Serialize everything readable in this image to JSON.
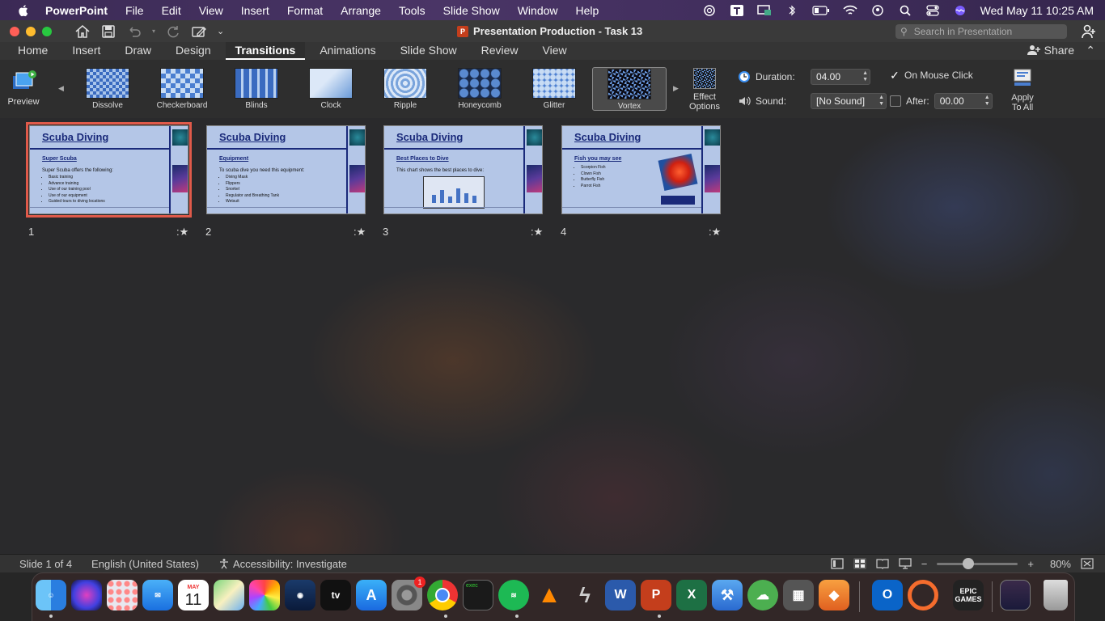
{
  "menubar": {
    "app_name": "PowerPoint",
    "items": [
      "File",
      "Edit",
      "View",
      "Insert",
      "Format",
      "Arrange",
      "Tools",
      "Slide Show",
      "Window",
      "Help"
    ],
    "clock": "Wed May 11  10:25 AM"
  },
  "titlebar": {
    "doc_title": "Presentation Production - Task 13",
    "search_placeholder": "Search in Presentation",
    "icon_letter": "P"
  },
  "ribbon_tabs": [
    "Home",
    "Insert",
    "Draw",
    "Design",
    "Transitions",
    "Animations",
    "Slide Show",
    "Review",
    "View"
  ],
  "active_tab": "Transitions",
  "share_label": "Share",
  "ribbon": {
    "preview_label": "Preview",
    "transitions": [
      "Dissolve",
      "Checkerboard",
      "Blinds",
      "Clock",
      "Ripple",
      "Honeycomb",
      "Glitter",
      "Vortex"
    ],
    "selected_transition": "Vortex",
    "effect_options_label": "Effect Options",
    "duration_label": "Duration:",
    "duration_value": "04.00",
    "sound_label": "Sound:",
    "sound_value": "[No Sound]",
    "on_mouse_click_label": "On Mouse Click",
    "on_mouse_click_checked": true,
    "after_label": "After:",
    "after_value": "00.00",
    "after_checked": false,
    "apply_to_all_label": "Apply To All"
  },
  "slides": [
    {
      "number": "1",
      "title": "Scuba Diving",
      "subtitle": "Super Scuba",
      "body": "Super Scuba offers the following:",
      "bullets": [
        "Basic training",
        "Advance training",
        "Use of our training pool",
        "Use of our equipment",
        "Guided tours to diving locations"
      ],
      "selected": true
    },
    {
      "number": "2",
      "title": "Scuba Diving",
      "subtitle": "Equipment",
      "body": "To scuba dive you need this equipment:",
      "bullets": [
        "Diving Mask",
        "Flippers",
        "Snorkel",
        "Regulator and Breathing Tank",
        "Wetsuit"
      ],
      "selected": false
    },
    {
      "number": "3",
      "title": "Scuba Diving",
      "subtitle": "Best Places to Dive",
      "body": "This chart shows the best places to dive:",
      "bullets": [],
      "selected": false
    },
    {
      "number": "4",
      "title": "Scuba Diving",
      "subtitle": "Fish you may see",
      "body": "",
      "bullets": [
        "Scorpion Fish",
        "Clown Fish",
        "Butterfly Fish",
        "Parrot Fish"
      ],
      "selected": false
    }
  ],
  "transition_marker": ":★",
  "statusbar": {
    "slide_info": "Slide 1 of 4",
    "language": "English (United States)",
    "accessibility": "Accessibility: Investigate",
    "zoom": "80%",
    "zoom_minus": "−",
    "zoom_plus": "+"
  },
  "dock": {
    "apps": [
      "Finder",
      "Siri",
      "Launchpad",
      "Mail",
      "Calendar",
      "Maps",
      "Photos",
      "Steam",
      "Apple TV",
      "App Store",
      "System Preferences",
      "Chrome",
      "Terminal",
      "Spotify",
      "VLC",
      "Creative Cloud",
      "Word",
      "PowerPoint",
      "Excel",
      "Xcode",
      "Cloud",
      "Calculator",
      "Sketch",
      "Outlook",
      "Origin",
      "Epic Games",
      "Screenshot",
      "Trash"
    ],
    "calendar_month": "MAY",
    "calendar_day": "11",
    "settings_badge": "1",
    "epic_label": "EPIC GAMES",
    "terminal_label": "exec",
    "tv_label": "tv",
    "word_letter": "W",
    "ppt_letter": "P",
    "excel_letter": "X"
  },
  "colors": {
    "accent": "#e05a4a",
    "slide_bg": "#b4c6e7",
    "slide_title": "#1a2a7a"
  }
}
